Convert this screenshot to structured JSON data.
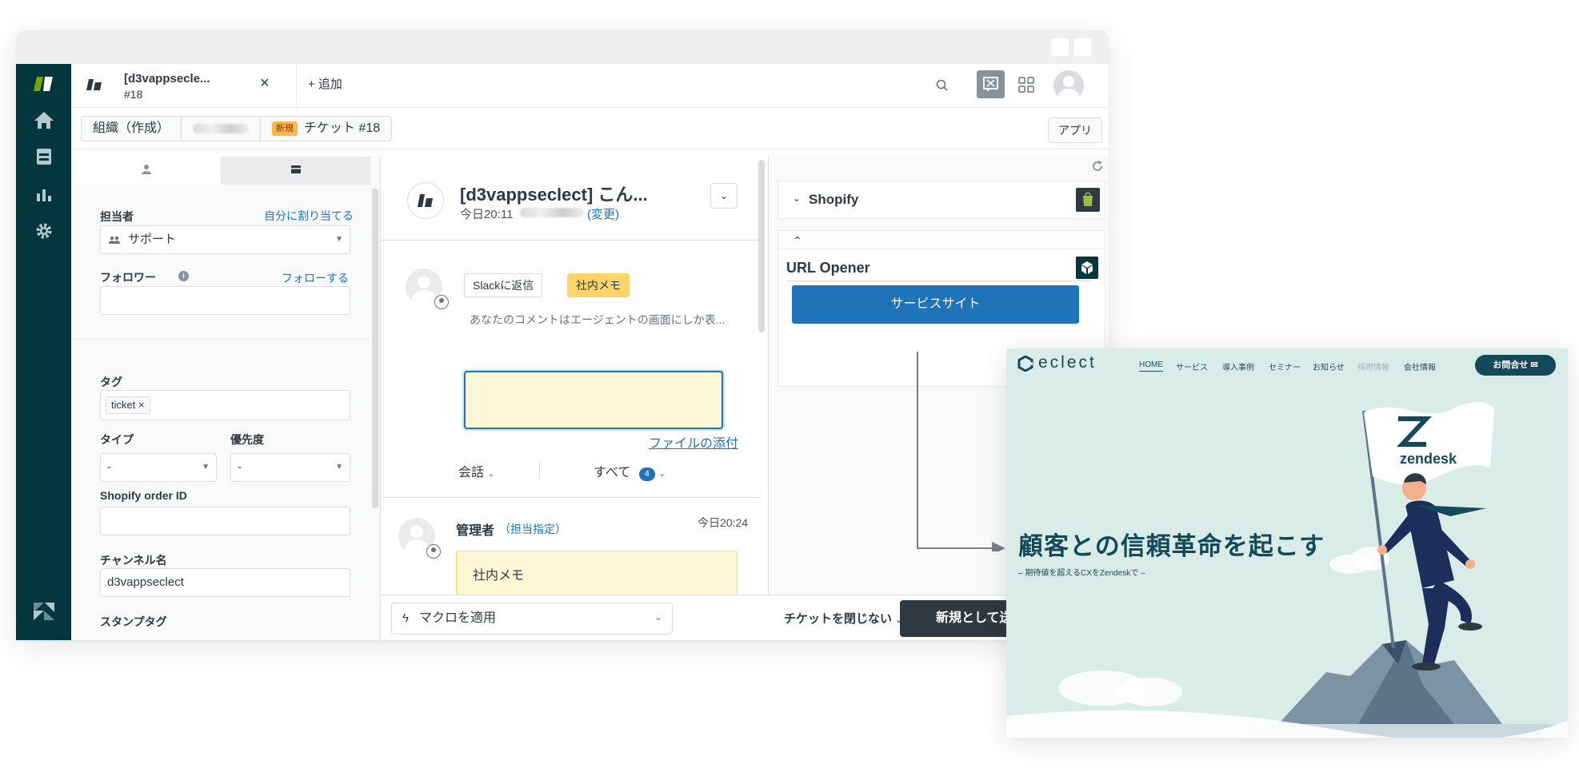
{
  "tab": {
    "title": "[d3vappsecle...",
    "number": "#18"
  },
  "topbar": {
    "add_label": "+ 追加"
  },
  "breadcrumb": {
    "org": "組織（作成）",
    "status_badge": "新規",
    "ticket": "チケット #18"
  },
  "apps_button": "アプリ",
  "left": {
    "assignee_label": "担当者",
    "assign_self": "自分に割り当てる",
    "assignee_value": "サポート",
    "followers_label": "フォロワー",
    "follow_link": "フォローする",
    "tags_label": "タグ",
    "tag": "ticket",
    "type_label": "タイプ",
    "type_value": "-",
    "priority_label": "優先度",
    "priority_value": "-",
    "shopify_label": "Shopify order ID",
    "shopify_value": "",
    "channel_label": "チャンネル名",
    "channel_value": "d3vappseclect",
    "stamp_label": "スタンプタグ"
  },
  "conversation": {
    "title": "[d3vappseclect] こん...",
    "time": "今日20:11",
    "change_link": "(変更)",
    "reply_slack": "Slackに返信",
    "internal_note": "社内メモ",
    "hint": "あなたのコメントはエージェントの画面にしか表...",
    "attach": "ファイルの添付",
    "filter_conversation": "会話",
    "filter_all": "すべて",
    "all_count": "4",
    "message": {
      "author": "管理者",
      "assign_link": "（担当指定）",
      "time": "今日20:24",
      "body": "社内メモ"
    }
  },
  "right": {
    "shopify_title": "Shopify",
    "url_opener_title": "URL Opener",
    "service_button": "サービスサイト"
  },
  "bottom": {
    "macro": "マクロを適用",
    "close_option": "チケットを閉じない",
    "submit": "新規として送信"
  },
  "website": {
    "logo": "eclect",
    "nav": [
      "HOME",
      "サービス",
      "導入事例",
      "セミナー",
      "お知らせ",
      "採用情報",
      "会社情報"
    ],
    "contact": "お問合せ",
    "headline": "顧客との信頼革命を起こす",
    "subline": "– 期待値を超えるCXをZendeskで –",
    "flag_text": "zendesk"
  },
  "colors": {
    "nav_bg": "#03363d",
    "brand_green": "#78a300",
    "primary_blue": "#1f73b7",
    "note_yellow": "#fff6d3",
    "site_bg": "#d9ece7",
    "site_navy": "#14495a"
  }
}
